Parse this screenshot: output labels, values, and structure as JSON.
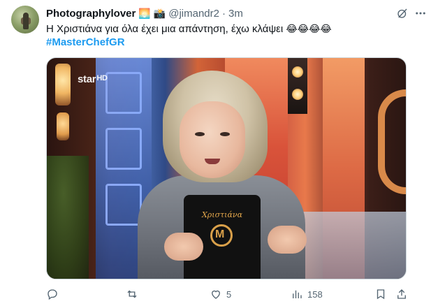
{
  "author": {
    "display_name": "Photographylover",
    "badges": [
      "🌅",
      "📸"
    ],
    "handle": "@jimandr2",
    "separator": "·",
    "time": "3m"
  },
  "tweet": {
    "text": "Η Χριστιάνα για όλα έχει μια απάντηση, έχω κλάψει",
    "emojis": "😂😂😂😂",
    "hashtag": "#MasterChefGR"
  },
  "media": {
    "watermark_main": "star",
    "watermark_suffix": "HD",
    "apron_label": "Χριστιάνα",
    "apron_logo": "M"
  },
  "actions": {
    "reply_count": "",
    "retweet_count": "",
    "like_count": "5",
    "views_count": "158"
  },
  "icons": {
    "top": [
      "grok-icon",
      "more-icon"
    ],
    "actions": [
      "reply-icon",
      "retweet-icon",
      "like-icon",
      "views-icon",
      "bookmark-icon",
      "share-icon"
    ]
  },
  "colors": {
    "text": "#0f1419",
    "muted": "#536471",
    "link": "#1d9bf0",
    "border": "#cfd9de"
  }
}
